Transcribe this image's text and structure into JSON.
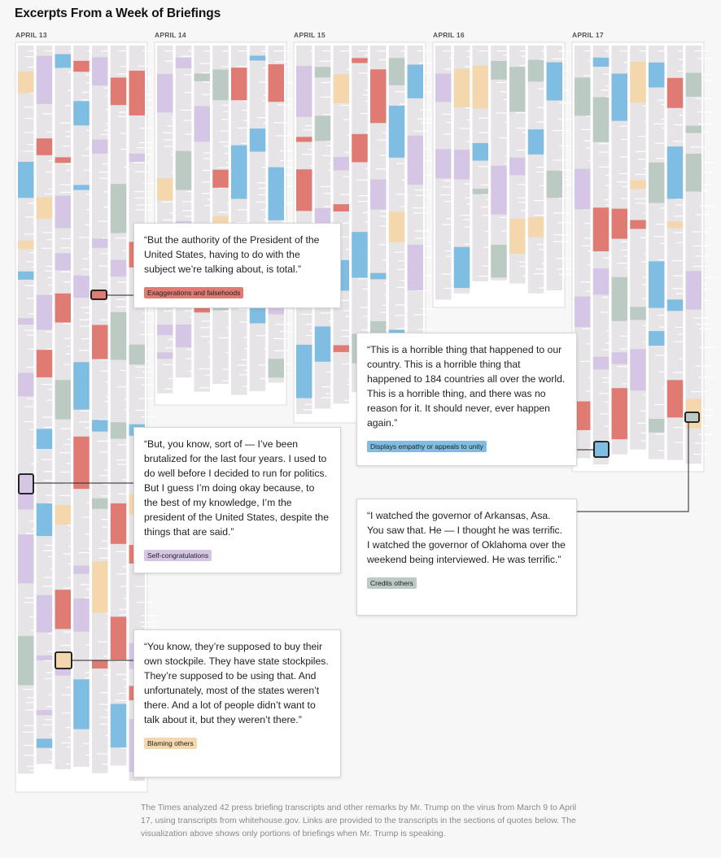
{
  "title": "Excerpts From a Week of Briefings",
  "colors": {
    "exaggerations": "#e07b74",
    "empathy": "#7fbde2",
    "self_congratulations": "#d6c6e6",
    "credits_others": "#bccac4",
    "blaming_others": "#f5d7ad",
    "neutral_text": "#e6e4e6",
    "panel_border": "#dcdcdc"
  },
  "chart_data": {
    "type": "heatmap",
    "title": "Excerpts From a Week of Briefings",
    "days": [
      {
        "label": "APRIL 13"
      },
      {
        "label": "APRIL 14"
      },
      {
        "label": "APRIL 15"
      },
      {
        "label": "APRIL 16"
      },
      {
        "label": "APRIL 17"
      }
    ],
    "categories": [
      "Exaggerations and falsehoods",
      "Displays empathy or appeals to unity",
      "Self-congratulations",
      "Credits others",
      "Blaming others"
    ],
    "callouts": [
      {
        "day": "APRIL 13",
        "quote": "“But the authority of the President of the United States, having to do with the subject we’re talking about, is total.”",
        "category": "Exaggerations and falsehoods"
      },
      {
        "day": "APRIL 13",
        "quote": "“But, you know, sort of — I’ve been brutalized for the last four years. I used to do well before I decided to run for politics. But I guess I’m doing okay because, to the best of my knowledge, I’m the president of the United States, despite the things that are said.”",
        "category": "Self-congratulations"
      },
      {
        "day": "APRIL 13",
        "quote": "“You know, they’re supposed to buy their own stockpile. They have state stockpiles. They’re supposed to be using that. And unfortunately, most of the states weren’t there. And a lot of people didn’t want to talk about it, but they weren’t there.”",
        "category": "Blaming others"
      },
      {
        "day": "APRIL 17",
        "quote": "“This is a horrible thing that happened to our country. This is a horrible thing that happened to 184 countries all over the world. This is a horrible thing, and there was no reason for it. It should never, ever happen again.”",
        "category": "Displays empathy or appeals to unity"
      },
      {
        "day": "APRIL 17",
        "quote": "“I watched the governor of Arkansas, Asa. You saw that. He — I thought he was terrific. I watched the governor of Oklahoma over the weekend being interviewed. He was terrific.”",
        "category": "Credits others"
      }
    ]
  },
  "footnote": "The Times analyzed 42 press briefing transcripts and other remarks by Mr. Trump on the virus from March 9 to April 17, using transcripts from whitehouse.gov. Links are provided to the transcripts in the sections of quotes below. The visualization above shows only portions of briefings when Mr. Trump is speaking."
}
